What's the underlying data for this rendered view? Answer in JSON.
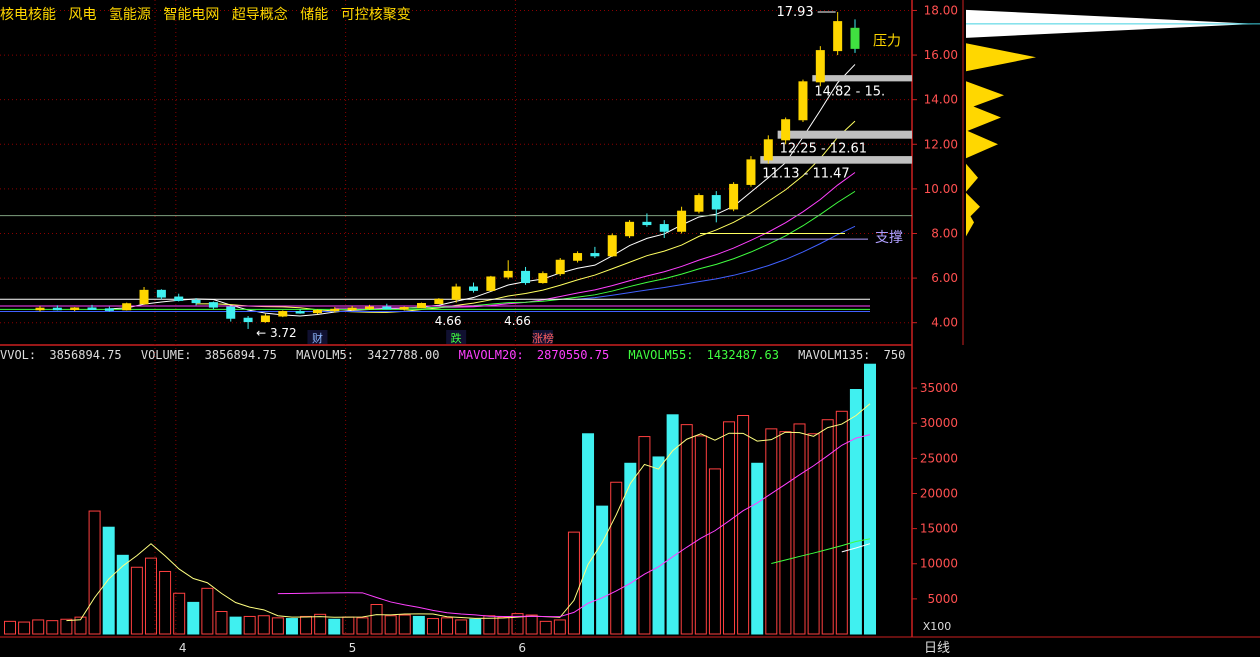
{
  "concepts": [
    "核电核能",
    "风电",
    "氢能源",
    "智能电网",
    "超导概念",
    "储能",
    "可控核聚变"
  ],
  "period_label": "日线",
  "vol_legend": [
    {
      "label": "VVOL:",
      "value": "3856894.75",
      "color": "#ffffff"
    },
    {
      "label": "VOLUME:",
      "value": "3856894.75",
      "color": "#ffffff"
    },
    {
      "label": "MAVOLM5:",
      "value": "3427788.00",
      "color": "#ffffff"
    },
    {
      "label": "MAVOLM20:",
      "value": "2870550.75",
      "color": "#ff40ff"
    },
    {
      "label": "MAVOLM55:",
      "value": "1432487.63",
      "color": "#40ff40"
    },
    {
      "label": "MAVOLM135:",
      "value": "750",
      "color": "#ffffff"
    }
  ],
  "colors": {
    "up": "#ffd700",
    "down": "#40f0f0",
    "bg": "#000000",
    "grid": "#8b0000",
    "axis": "#cc2020",
    "vol_up": "#ff4040",
    "vol_down": "#40f0f0",
    "flat": "#40c040"
  },
  "chart_data": [
    {
      "type": "candlestick",
      "y_ticks": [
        "4.00",
        "6.00",
        "8.00",
        "10.00",
        "12.00",
        "14.00",
        "16.00",
        "18.00"
      ],
      "ylim": [
        3.0,
        18.2
      ],
      "x_months": [
        "4",
        "5",
        "6"
      ],
      "x_month_index": [
        8,
        18,
        28
      ],
      "ohlc": [
        [
          4.6,
          4.75,
          4.5,
          4.65
        ],
        [
          4.65,
          4.78,
          4.55,
          4.6
        ],
        [
          4.6,
          4.7,
          4.52,
          4.66
        ],
        [
          4.66,
          4.8,
          4.58,
          4.62
        ],
        [
          4.62,
          4.72,
          4.5,
          4.58
        ],
        [
          4.58,
          4.9,
          4.55,
          4.85
        ],
        [
          4.85,
          5.6,
          4.8,
          5.45
        ],
        [
          5.45,
          5.5,
          5.05,
          5.15
        ],
        [
          5.15,
          5.3,
          4.95,
          5.0
        ],
        [
          5.0,
          5.1,
          4.78,
          4.9
        ],
        [
          4.9,
          4.95,
          4.6,
          4.7
        ],
        [
          4.7,
          4.75,
          4.05,
          4.2
        ],
        [
          4.2,
          4.3,
          3.72,
          4.05
        ],
        [
          4.05,
          4.4,
          4.0,
          4.3
        ],
        [
          4.3,
          4.55,
          4.25,
          4.5
        ],
        [
          4.5,
          4.6,
          4.4,
          4.45
        ],
        [
          4.45,
          4.6,
          4.38,
          4.55
        ],
        [
          4.55,
          4.7,
          4.45,
          4.6
        ],
        [
          4.6,
          4.75,
          4.52,
          4.65
        ],
        [
          4.65,
          4.8,
          4.58,
          4.7
        ],
        [
          4.7,
          4.85,
          4.6,
          4.62
        ],
        [
          4.62,
          4.72,
          4.55,
          4.68
        ],
        [
          4.68,
          4.9,
          4.65,
          4.86
        ],
        [
          4.86,
          5.1,
          4.85,
          5.05
        ],
        [
          5.05,
          5.75,
          4.9,
          5.6
        ],
        [
          5.6,
          5.8,
          5.35,
          5.45
        ],
        [
          5.45,
          6.1,
          5.4,
          6.05
        ],
        [
          6.05,
          6.8,
          5.95,
          6.3
        ],
        [
          6.3,
          6.5,
          5.7,
          5.8
        ],
        [
          5.8,
          6.3,
          5.75,
          6.2
        ],
        [
          6.2,
          6.9,
          6.1,
          6.8
        ],
        [
          6.8,
          7.2,
          6.7,
          7.1
        ],
        [
          7.1,
          7.4,
          6.9,
          7.0
        ],
        [
          7.0,
          8.0,
          6.95,
          7.9
        ],
        [
          7.9,
          8.6,
          7.8,
          8.5
        ],
        [
          8.5,
          8.9,
          8.3,
          8.4
        ],
        [
          8.4,
          8.6,
          7.8,
          8.1
        ],
        [
          8.1,
          9.2,
          8.0,
          9.0
        ],
        [
          9.0,
          9.8,
          8.9,
          9.7
        ],
        [
          9.7,
          9.9,
          8.5,
          9.1
        ],
        [
          9.1,
          10.3,
          9.0,
          10.2
        ],
        [
          10.2,
          11.47,
          10.1,
          11.3
        ],
        [
          11.3,
          12.4,
          11.13,
          12.2
        ],
        [
          12.2,
          13.2,
          12.0,
          13.1
        ],
        [
          13.1,
          14.9,
          13.0,
          14.8
        ],
        [
          14.8,
          16.4,
          14.6,
          16.2
        ],
        [
          16.2,
          17.93,
          16.0,
          17.5
        ],
        [
          17.2,
          17.6,
          16.1,
          16.3
        ]
      ],
      "annotations": [
        {
          "text": "17.93",
          "index": 46,
          "value": 17.93
        },
        {
          "text": "压力",
          "index": 47,
          "value": 16.6
        },
        {
          "text": "支撑",
          "index": 47,
          "value": 7.8
        },
        {
          "text": "3.72",
          "index": 12,
          "value": 3.72
        },
        {
          "text": "4.66",
          "index": 24,
          "value": 4.25
        },
        {
          "text": "4.66",
          "index": 28,
          "value": 4.25
        }
      ],
      "resistance_zones": [
        {
          "label": "14.82 - 15.",
          "low": 14.82,
          "high": 15.1,
          "from": 45
        },
        {
          "label": "12.25 - 12.61",
          "low": 12.25,
          "high": 12.61,
          "from": 43
        },
        {
          "label": "11.13 - 11.47",
          "low": 11.13,
          "high": 11.47,
          "from": 42
        }
      ],
      "event_markers": [
        {
          "text": "财",
          "index": 16,
          "color": "#8fb8ff"
        },
        {
          "text": "跌",
          "index": 24,
          "color": "#40ff40"
        },
        {
          "text": "涨榜",
          "index": 29,
          "color": "#ff6060"
        }
      ],
      "support_line": 8.0,
      "reference_line": 8.8,
      "volume_profile": [
        {
          "price": 17.4,
          "width": 290,
          "color": "#ffffff"
        },
        {
          "price": 15.9,
          "width": 70,
          "color": "#ffd700"
        },
        {
          "price": 14.2,
          "width": 38,
          "color": "#ffd700"
        },
        {
          "price": 13.2,
          "width": 35,
          "color": "#ffd700"
        },
        {
          "price": 12.0,
          "width": 32,
          "color": "#ffd700"
        },
        {
          "price": 10.5,
          "width": 12,
          "color": "#ffd700"
        },
        {
          "price": 9.2,
          "width": 14,
          "color": "#ffd700"
        },
        {
          "price": 8.5,
          "width": 8,
          "color": "#ffd700"
        }
      ]
    },
    {
      "type": "bar",
      "y_ticks": [
        "5000",
        "10000",
        "15000",
        "20000",
        "25000",
        "30000",
        "35000"
      ],
      "ylim": [
        0,
        39000
      ],
      "unit_label": "X100",
      "volumes": [
        1800,
        1700,
        2000,
        1900,
        2100,
        2400,
        17500,
        15200,
        11200,
        9500,
        10800,
        8900,
        5800,
        4500,
        6500,
        3200,
        2400,
        2500,
        2600,
        2300,
        2200,
        2500,
        2800,
        2100,
        2400,
        2300,
        4200,
        2600,
        2700,
        2500,
        2200,
        2300,
        2000,
        2100,
        2600,
        2400,
        2900,
        2700,
        1800,
        2000,
        14500,
        28500,
        18200,
        21600,
        24300,
        28100,
        25200,
        31200,
        29800,
        28200,
        23500,
        30200,
        31100,
        24300,
        29200,
        28800,
        29900,
        28500,
        30500,
        31700,
        34800,
        38400
      ]
    }
  ]
}
